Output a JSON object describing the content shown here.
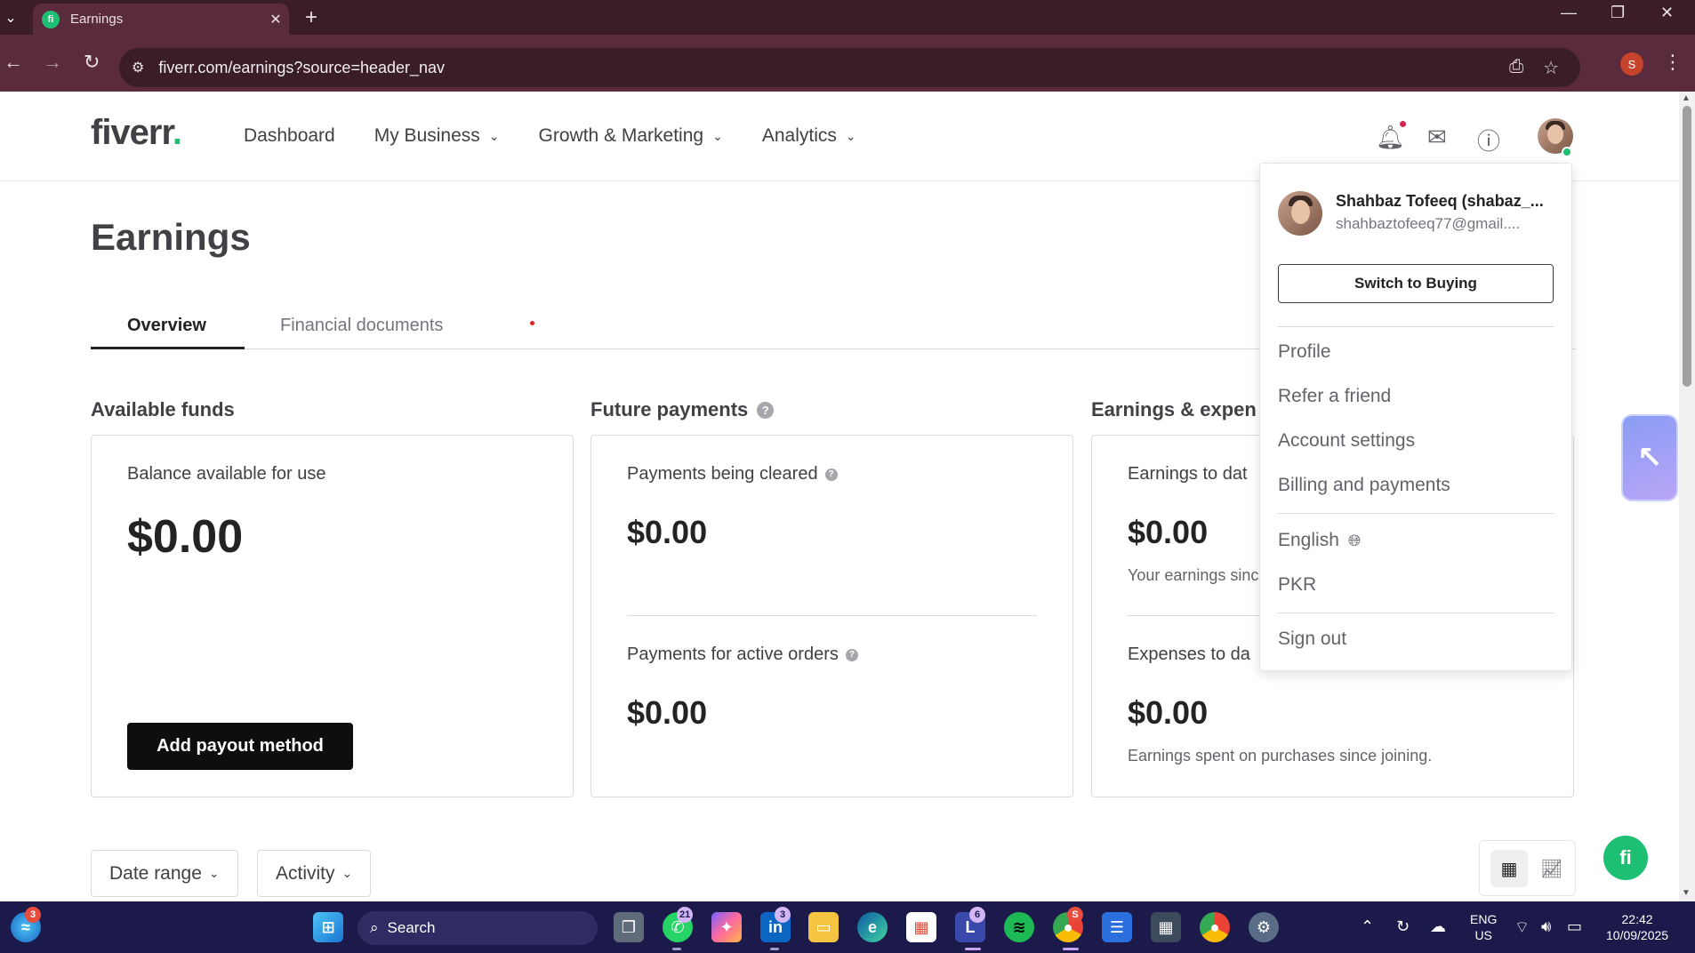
{
  "browser": {
    "tab_title": "Earnings",
    "tab_favicon_text": "fi",
    "url": "fiverr.com/earnings?source=header_nav",
    "profile_initial": "S"
  },
  "header": {
    "logo_text": "fiverr",
    "logo_dot": ".",
    "nav": [
      {
        "label": "Dashboard"
      },
      {
        "label": "My Business"
      },
      {
        "label": "Growth & Marketing"
      },
      {
        "label": "Analytics"
      }
    ]
  },
  "page": {
    "title": "Earnings",
    "tabs": [
      {
        "label": "Overview",
        "active": true
      },
      {
        "label": "Financial documents",
        "active": false
      }
    ]
  },
  "sections": {
    "available_funds": {
      "title": "Available funds",
      "label": "Balance available for use",
      "amount": "$0.00",
      "button": "Add payout method"
    },
    "future_payments": {
      "title": "Future payments",
      "cleared_label": "Payments being cleared",
      "cleared_amount": "$0.00",
      "active_label": "Payments for active orders",
      "active_amount": "$0.00"
    },
    "earnings_expenses": {
      "title": "Earnings & expen",
      "earnings_label": "Earnings to dat",
      "earnings_amount": "$0.00",
      "earnings_note": "Your earnings sinc",
      "expenses_label": "Expenses to da",
      "expenses_amount": "$0.00",
      "expenses_note": "Earnings spent on purchases since joining."
    }
  },
  "filters": {
    "date_range": "Date range",
    "activity": "Activity"
  },
  "fab_text": "fi",
  "dropdown": {
    "name": "Shahbaz Tofeeq (shabaz_...",
    "email": "shahbaztofeeq77@gmail....",
    "switch_label": "Switch to Buying",
    "items": [
      {
        "label": "Profile"
      },
      {
        "label": "Refer a friend"
      },
      {
        "label": "Account settings"
      },
      {
        "label": "Billing and payments"
      }
    ],
    "language": "English",
    "currency": "PKR",
    "sign_out": "Sign out"
  },
  "taskbar": {
    "search_label": "Search",
    "badges": {
      "copilot": "3",
      "whatsapp": "21",
      "linkedin": "3",
      "app_l": "6",
      "chrome": "S"
    },
    "lang_top": "ENG",
    "lang_bottom": "US",
    "time": "22:42",
    "date": "10/09/2025"
  },
  "colors": {
    "brand_green": "#1dbf73",
    "browser_frame": "#3b1d2a",
    "taskbar": "#1c1a4a"
  }
}
